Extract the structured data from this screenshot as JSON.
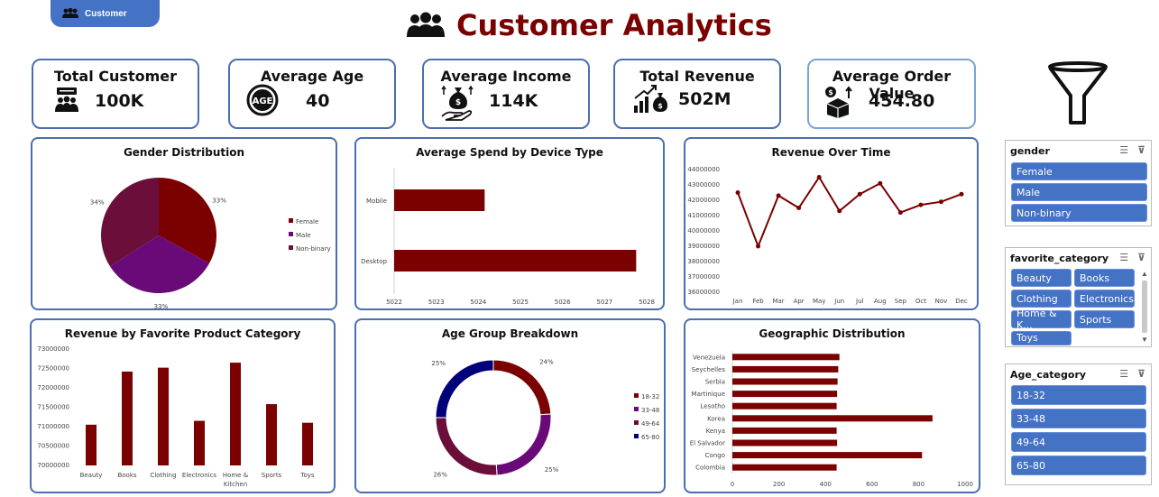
{
  "tab": {
    "label": "Customer",
    "icon": "people-icon"
  },
  "page_title": "Customer Analytics",
  "kpis": [
    {
      "title": "Total Customer",
      "value": "100K",
      "icon": "customer-chat-icon"
    },
    {
      "title": "Average Age",
      "value": "40",
      "icon": "age-icon"
    },
    {
      "title": "Average Income",
      "value": "114K",
      "icon": "income-hand-icon"
    },
    {
      "title": "Total Revenue",
      "value": "502M",
      "icon": "revenue-growth-icon"
    },
    {
      "title": "Average Order Value",
      "value": "454.80",
      "icon": "order-box-icon"
    }
  ],
  "filter_icon": "funnel-icon",
  "slicers": [
    {
      "title": "gender",
      "items": [
        "Female",
        "Male",
        "Non-binary"
      ]
    },
    {
      "title": "favorite_category",
      "items": [
        "Beauty",
        "Books",
        "Clothing",
        "Electronics",
        "Home & K...",
        "Sports",
        "Toys"
      ]
    },
    {
      "title": "Age_category",
      "items": [
        "18-32",
        "33-48",
        "49-64",
        "65-80"
      ]
    }
  ],
  "colors": {
    "accent": "#7b0000",
    "male": "#6a0a78",
    "nonbinary": "#6b0f3a",
    "navy": "#00007a",
    "border": "#4a6fb0",
    "slicer": "#4472c4"
  },
  "chart_data": [
    {
      "type": "pie",
      "title": "Gender Distribution",
      "categories": [
        "Female",
        "Male",
        "Non-binary"
      ],
      "values": [
        33,
        33,
        34
      ],
      "labels": [
        "33%",
        "33%",
        "34%"
      ],
      "legend": "right"
    },
    {
      "type": "bar",
      "orientation": "horizontal",
      "title": "Average Spend by Device Type",
      "categories": [
        "Mobile",
        "Desktop"
      ],
      "values": [
        5024.15,
        5027.75
      ],
      "xlim": [
        5022,
        5028
      ],
      "xticks": [
        "5022",
        "5023",
        "5024",
        "5025",
        "5026",
        "5027",
        "5028"
      ]
    },
    {
      "type": "line",
      "title": "Revenue Over Time",
      "categories": [
        "Jan",
        "Feb",
        "Mar",
        "Apr",
        "May",
        "Jun",
        "Jul",
        "Aug",
        "Sep",
        "Oct",
        "Nov",
        "Dec"
      ],
      "values": [
        42500000,
        39000000,
        42300000,
        41500000,
        43500000,
        41300000,
        42400000,
        43100000,
        41200000,
        41700000,
        41900000,
        42400000
      ],
      "ylim": [
        36000000,
        44000000
      ],
      "yticks": [
        "36000000",
        "37000000",
        "38000000",
        "39000000",
        "40000000",
        "41000000",
        "42000000",
        "43000000",
        "44000000"
      ]
    },
    {
      "type": "bar",
      "title": "Revenue by Favorite Product Category",
      "categories": [
        "Beauty",
        "Books",
        "Clothing",
        "Electronics",
        "Home & Kitchen",
        "Sports",
        "Toys"
      ],
      "values": [
        71050000,
        72420000,
        72520000,
        71150000,
        72650000,
        71580000,
        71100000
      ],
      "ylim": [
        70000000,
        73000000
      ],
      "yticks": [
        "70000000",
        "70500000",
        "71000000",
        "71500000",
        "72000000",
        "72500000",
        "73000000"
      ]
    },
    {
      "type": "pie",
      "donut": true,
      "title": "Age Group Breakdown",
      "categories": [
        "18-32",
        "33-48",
        "49-64",
        "65-80"
      ],
      "values": [
        24,
        25,
        26,
        25
      ],
      "labels": [
        "24%",
        "25%",
        "26%",
        "25%"
      ],
      "legend": "right"
    },
    {
      "type": "bar",
      "orientation": "horizontal",
      "title": "Geographic Distribution",
      "categories": [
        "Venezuela",
        "Seychelles",
        "Serbia",
        "Martinique",
        "Lesotho",
        "Korea",
        "Kenya",
        "El Salvador",
        "Congo",
        "Colombia"
      ],
      "values": [
        460,
        455,
        452,
        450,
        448,
        860,
        448,
        450,
        815,
        448
      ],
      "xlim": [
        0,
        1000
      ],
      "xticks": [
        "0",
        "200",
        "400",
        "600",
        "800",
        "1000"
      ]
    }
  ]
}
